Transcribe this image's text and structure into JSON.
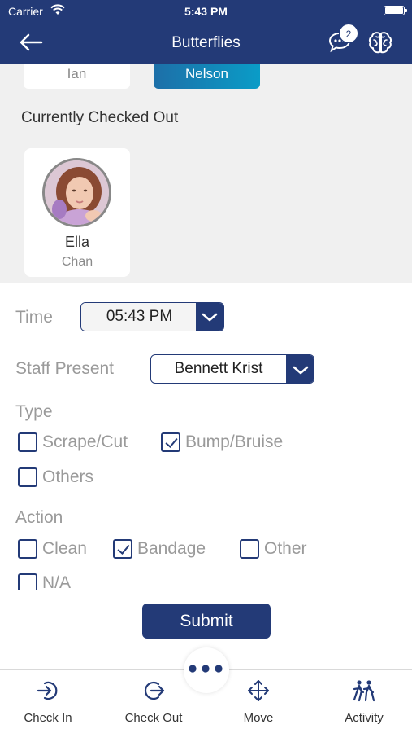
{
  "status_bar": {
    "carrier": "Carrier",
    "time": "5:43 PM"
  },
  "header": {
    "title": "Butterflies",
    "chat_badge_count": "2"
  },
  "top_cards": {
    "left_name": "Ian",
    "right_name": "Nelson"
  },
  "checked_out": {
    "section_title": "Currently Checked Out",
    "child": {
      "first_name": "Ella",
      "last_name": "Chan"
    }
  },
  "form": {
    "time_label": "Time",
    "time_value": "05:43 PM",
    "staff_label": "Staff Present",
    "staff_value": "Bennett Krist",
    "type_label": "Type",
    "type_options": [
      {
        "label": "Scrape/Cut",
        "checked": false
      },
      {
        "label": "Bump/Bruise",
        "checked": true
      },
      {
        "label": "Others",
        "checked": false
      }
    ],
    "action_label": "Action",
    "action_options": [
      {
        "label": "Clean",
        "checked": false
      },
      {
        "label": "Bandage",
        "checked": true
      },
      {
        "label": "Other",
        "checked": false
      },
      {
        "label": "N/A",
        "checked": false
      }
    ],
    "submit_label": "Submit"
  },
  "tab_bar": {
    "tabs": [
      {
        "label": "Check In",
        "icon": "check-in-icon"
      },
      {
        "label": "Check Out",
        "icon": "check-out-icon"
      },
      {
        "label": "Move",
        "icon": "move-icon"
      },
      {
        "label": "Activity",
        "icon": "activity-icon"
      }
    ],
    "more_icon": "more-dots-icon"
  },
  "colors": {
    "primary": "#233a77",
    "accent_gradient_start": "#1d6fa8",
    "accent_gradient_end": "#0a9cc7"
  }
}
